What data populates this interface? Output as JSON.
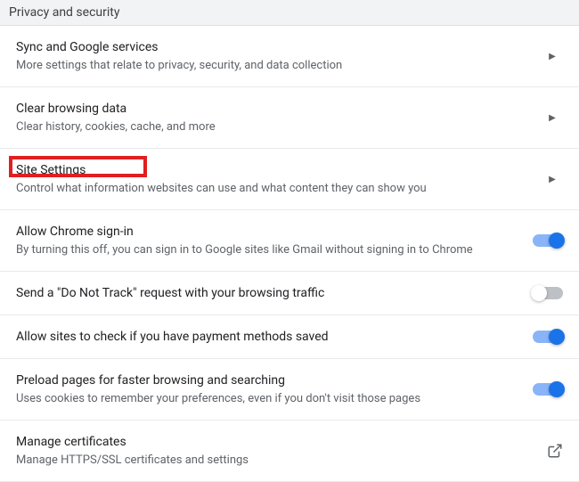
{
  "header": {
    "title": "Privacy and security"
  },
  "rows": [
    {
      "title": "Sync and Google services",
      "desc": "More settings that relate to privacy, security, and data collection",
      "type": "nav"
    },
    {
      "title": "Clear browsing data",
      "desc": "Clear history, cookies, cache, and more",
      "type": "nav"
    },
    {
      "title": "Site Settings",
      "desc": "Control what information websites can use and what content they can show you",
      "type": "nav",
      "highlighted": true
    },
    {
      "title": "Allow Chrome sign-in",
      "desc": "By turning this off, you can sign in to Google sites like Gmail without signing in to Chrome",
      "type": "toggle",
      "value": true
    },
    {
      "title": "Send a \"Do Not Track\" request with your browsing traffic",
      "desc": "",
      "type": "toggle",
      "value": false
    },
    {
      "title": "Allow sites to check if you have payment methods saved",
      "desc": "",
      "type": "toggle",
      "value": true
    },
    {
      "title": "Preload pages for faster browsing and searching",
      "desc": "Uses cookies to remember your preferences, even if you don't visit those pages",
      "type": "toggle",
      "value": true
    },
    {
      "title": "Manage certificates",
      "desc": "Manage HTTPS/SSL certificates and settings",
      "type": "external"
    }
  ]
}
